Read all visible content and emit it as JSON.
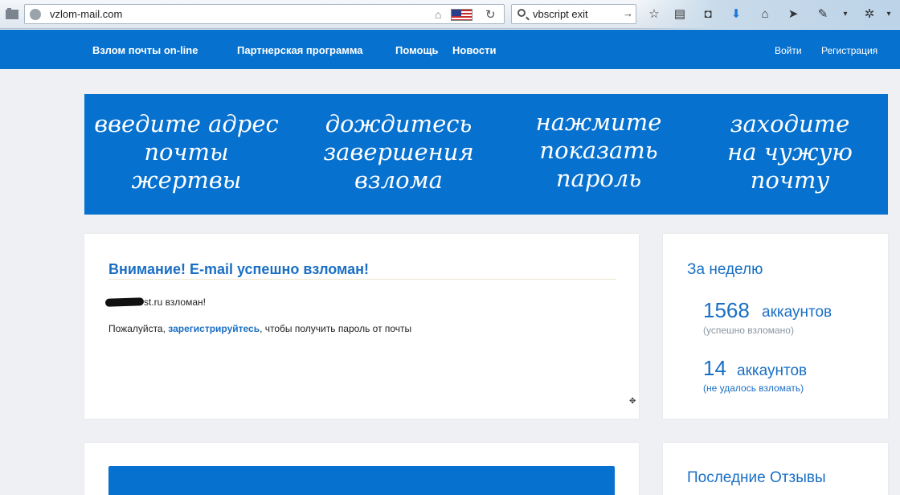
{
  "browser": {
    "url": "vzlom-mail.com",
    "search_query": "vbscript exit"
  },
  "nav": {
    "items": [
      "Взлом почты on-line",
      "Партнерская программа",
      "Помощь",
      "Новости"
    ],
    "login": "Войти",
    "register": "Регистрация"
  },
  "hero": {
    "steps": [
      [
        "введите адрес",
        "почты",
        "жертвы"
      ],
      [
        "дождитесь",
        "завершения",
        "взлома"
      ],
      [
        "нажмите",
        "показать",
        "пароль"
      ],
      [
        "заходите",
        "на чужую",
        "почту"
      ]
    ]
  },
  "alert": {
    "title": "Внимание! E-mail успешно взломан!",
    "hacked_text": "st.ru взломан!",
    "register_prefix": "Пожалуйста, ",
    "register_link": "зарегистрируйтесь",
    "register_suffix": ", чтобы получить пароль от почты"
  },
  "stats": {
    "title": "За неделю",
    "success_count": "1568",
    "success_unit": "аккаунтов",
    "success_note": "(успешно взломано)",
    "fail_count": "14",
    "fail_unit": "аккаунтов",
    "fail_note": "(не удалось взломать)"
  },
  "reviews": {
    "title": "Последние Отзывы"
  },
  "colors": {
    "brand_blue": "#0671cf",
    "link_blue": "#1a6fc4",
    "page_bg": "#eef0f3"
  }
}
